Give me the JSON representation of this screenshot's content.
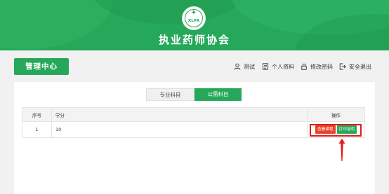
{
  "header": {
    "logo_text": "XLPA",
    "title": "执业药师协会"
  },
  "nav": {
    "center_label": "管理中心",
    "menu": [
      {
        "label": "测试",
        "icon": "user-icon"
      },
      {
        "label": "个人资料",
        "icon": "document-icon"
      },
      {
        "label": "修改密码",
        "icon": "lock-icon"
      },
      {
        "label": "安全退出",
        "icon": "logout-icon"
      }
    ]
  },
  "tabs": [
    {
      "label": "专业科目",
      "active": false
    },
    {
      "label": "公需科目",
      "active": true
    }
  ],
  "table": {
    "columns": [
      "序号",
      "学分",
      "操作"
    ],
    "rows": [
      {
        "index": "1",
        "credits": "10",
        "actions": [
          "查看课程",
          "打印证明"
        ]
      }
    ]
  },
  "colors": {
    "brand_green": "#26a85a",
    "action_red": "#e8432c",
    "highlight_red": "#e21b1b"
  }
}
